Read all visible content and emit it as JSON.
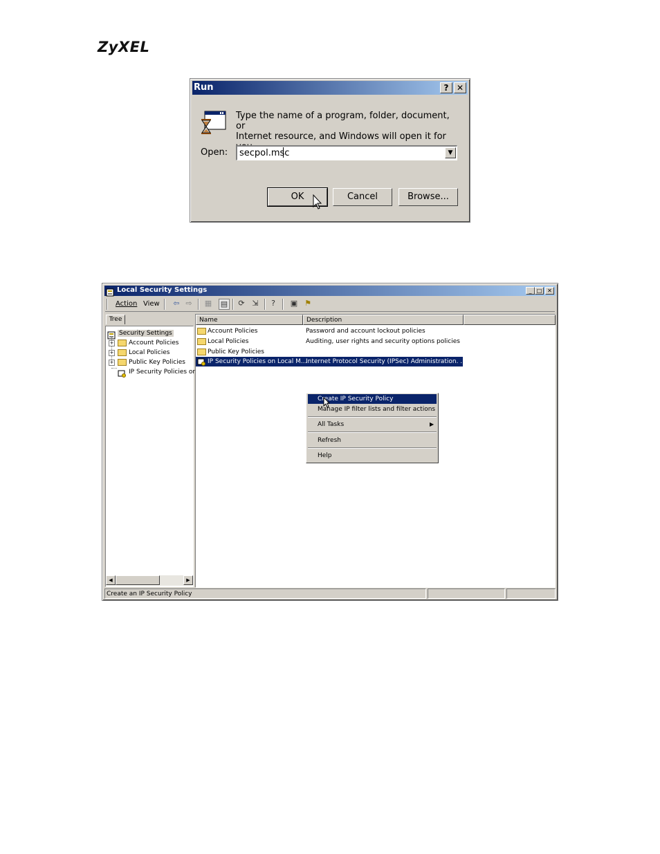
{
  "logo": "ZyXEL",
  "run_dialog": {
    "title": "Run",
    "help_btn": "?",
    "close_btn": "✕",
    "prompt_line1": "Type the name of a program, folder, document, or",
    "prompt_line2": "Internet resource, and Windows will open it for you.",
    "open_label": "Open:",
    "open_value": "secpol.msc",
    "ok_label": "OK",
    "cancel_label": "Cancel",
    "browse_label": "Browse..."
  },
  "lss_window": {
    "title": "Local Security Settings",
    "menu": {
      "action": "Action",
      "view": "View"
    },
    "tree_tab": "Tree",
    "tree": [
      "Security Settings",
      "Account Policies",
      "Local Policies",
      "Public Key Policies",
      "IP Security Policies on"
    ],
    "columns": {
      "name": "Name",
      "description": "Description"
    },
    "rows": [
      {
        "name": "Account Policies",
        "description": "Password and account lockout policies"
      },
      {
        "name": "Local Policies",
        "description": "Auditing, user rights and security options policies"
      },
      {
        "name": "Public Key Policies",
        "description": ""
      },
      {
        "name": "IP Security Policies on Local M...",
        "description": "Internet Protocol Security (IPSec) Administration. ..."
      }
    ],
    "context_menu": {
      "create": "Create IP Security Policy",
      "manage": "Manage IP filter lists and filter actions",
      "all_tasks": "All Tasks",
      "refresh": "Refresh",
      "help": "Help"
    },
    "status": "Create an IP Security Policy"
  }
}
